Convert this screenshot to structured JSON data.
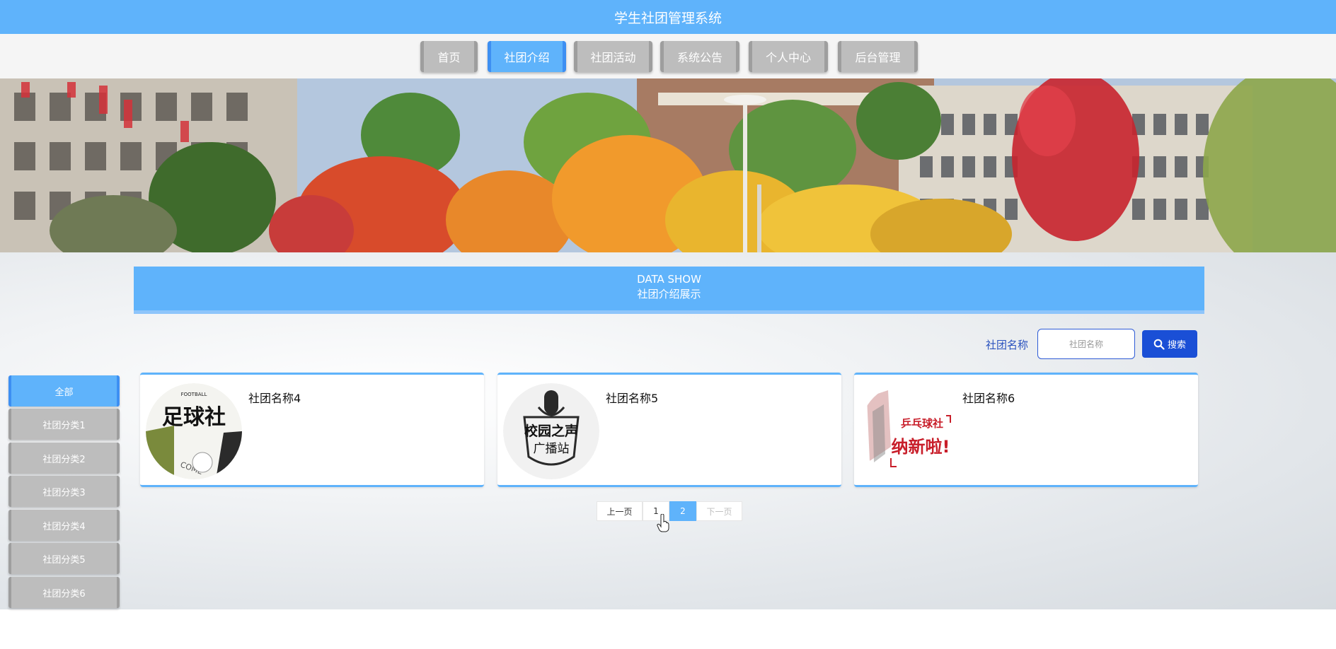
{
  "header": {
    "title": "学生社团管理系统"
  },
  "nav": {
    "items": [
      {
        "label": "首页"
      },
      {
        "label": "社团介绍",
        "active": true
      },
      {
        "label": "社团活动"
      },
      {
        "label": "系统公告"
      },
      {
        "label": "个人中心"
      },
      {
        "label": "后台管理"
      }
    ]
  },
  "section": {
    "kicker": "DATA SHOW",
    "title": "社团介绍展示"
  },
  "search": {
    "label": "社团名称",
    "placeholder": "社团名称",
    "button_label": "搜索",
    "icon": "search-icon"
  },
  "sidebar": {
    "items": [
      {
        "label": "全部",
        "active": true
      },
      {
        "label": "社团分类1"
      },
      {
        "label": "社团分类2"
      },
      {
        "label": "社团分类3"
      },
      {
        "label": "社团分类4"
      },
      {
        "label": "社团分类5"
      },
      {
        "label": "社团分类6"
      }
    ]
  },
  "cards": [
    {
      "title": "社团名称4",
      "image_text": [
        "FOOTBALL",
        "足球社",
        "COME"
      ]
    },
    {
      "title": "社团名称5",
      "image_text": [
        "校园之声",
        "广播站"
      ]
    },
    {
      "title": "社团名称6",
      "image_text": [
        "乒乓球社",
        "纳新啦!"
      ]
    }
  ],
  "pagination": {
    "prev_label": "上一页",
    "pages": [
      "1",
      "2"
    ],
    "current_page": "2",
    "next_label": "下一页"
  },
  "colors": {
    "primary": "#5fb3fb",
    "primary_dark": "#1a4fd6",
    "inactive": "#bdbdbd"
  }
}
